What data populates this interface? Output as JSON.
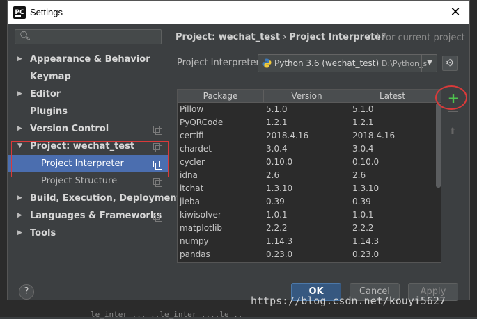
{
  "window": {
    "title": "Settings",
    "app_icon": "PC"
  },
  "sidebar": {
    "items": [
      {
        "label": "Appearance & Behavior",
        "expanded": false
      },
      {
        "label": "Keymap"
      },
      {
        "label": "Editor",
        "expanded": false
      },
      {
        "label": "Plugins"
      },
      {
        "label": "Version Control",
        "expanded": false
      },
      {
        "label": "Project: wechat_test",
        "expanded": true
      },
      {
        "label": "Project Interpreter",
        "selected": true
      },
      {
        "label": "Project Structure"
      },
      {
        "label": "Build, Execution, Deployment",
        "expanded": false
      },
      {
        "label": "Languages & Frameworks",
        "expanded": false
      },
      {
        "label": "Tools",
        "expanded": false
      }
    ]
  },
  "main": {
    "breadcrumb": [
      "Project: wechat_test",
      "Project Interpreter"
    ],
    "breadcrumb_sep": "›",
    "for_current_project": "For current project",
    "interpreter_label": "Project Interpreter:",
    "interpreter_value": "Python 3.6 (wechat_test)",
    "interpreter_path": "D:\\Python_s",
    "table": {
      "columns": [
        "Package",
        "Version",
        "Latest"
      ],
      "rows": [
        [
          "Pillow",
          "5.1.0",
          "5.1.0"
        ],
        [
          "PyQRCode",
          "1.2.1",
          "1.2.1"
        ],
        [
          "certifi",
          "2018.4.16",
          "2018.4.16"
        ],
        [
          "chardet",
          "3.0.4",
          "3.0.4"
        ],
        [
          "cycler",
          "0.10.0",
          "0.10.0"
        ],
        [
          "idna",
          "2.6",
          "2.6"
        ],
        [
          "itchat",
          "1.3.10",
          "1.3.10"
        ],
        [
          "jieba",
          "0.39",
          "0.39"
        ],
        [
          "kiwisolver",
          "1.0.1",
          "1.0.1"
        ],
        [
          "matplotlib",
          "2.2.2",
          "2.2.2"
        ],
        [
          "numpy",
          "1.14.3",
          "1.14.3"
        ],
        [
          "pandas",
          "0.23.0",
          "0.23.0"
        ]
      ]
    },
    "add_symbol": "+"
  },
  "footer": {
    "help": "?",
    "ok": "OK",
    "cancel": "Cancel",
    "apply": "Apply"
  },
  "watermark": "https://blog.csdn.net/kouyi5627",
  "background_text": "le_inter    ... ..le_inter ....le ..",
  "colors": {
    "selection": "#4b6eaf",
    "highlight_annotation": "#d93a3a",
    "add_button": "#4ec34e",
    "ok_button": "#365880"
  },
  "icons": {
    "search": "search-icon",
    "close": "close-icon",
    "gear": "gear-icon",
    "python": "python-icon",
    "add": "plus-icon",
    "remove": "minus-icon",
    "upgrade": "up-arrow-icon",
    "help": "help-icon"
  }
}
